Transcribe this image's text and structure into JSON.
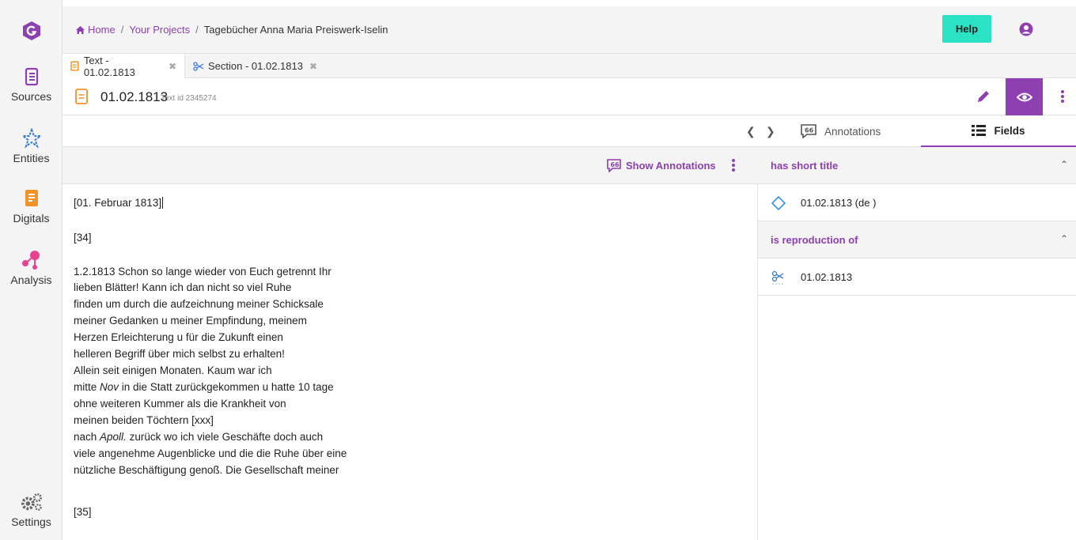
{
  "breadcrumb": {
    "home": "Home",
    "projects": "Your Projects",
    "current": "Tagebücher Anna Maria Preiswerk-Iselin"
  },
  "header": {
    "help_label": "Help"
  },
  "sidebar": {
    "items": [
      {
        "label": "Sources",
        "icon": "scroll-icon"
      },
      {
        "label": "Entities",
        "icon": "star-icon"
      },
      {
        "label": "Digitals",
        "icon": "document-icon"
      },
      {
        "label": "Analysis",
        "icon": "network-icon"
      },
      {
        "label": "Settings",
        "icon": "gears-icon"
      }
    ]
  },
  "tabs": [
    {
      "label": "Text - 01.02.1813",
      "close": "✖"
    },
    {
      "label": "Section - 01.02.1813",
      "close": "✖"
    }
  ],
  "document": {
    "title": "01.02.1813",
    "subtitle": "Text id 2345274"
  },
  "toolbar": {
    "show_annotations": "Show Annotations"
  },
  "text": {
    "lines": [
      "[01. Februar 1813]",
      "[34]",
      "1.2.1813 Schon so lange wieder von Euch getrennt Ihr",
      "lieben Blätter! Kann ich dan nicht so viel Ruhe",
      "finden um durch die aufzeichnung meiner Schicksale",
      "meiner Gedanken u meiner Empfindung, meinem",
      "Herzen Erleichterung u für die Zukunft einen",
      "helleren Begriff über mich selbst zu erhalten!",
      "Allein seit einigen Monaten. Kaum war ich",
      "mitte ",
      "Nov",
      " in die Statt zurückgekommen u hatte 10 tage",
      "ohne weiteren Kummer als die Krankheit von",
      "meinen beiden Töchtern [xxx]",
      "nach ",
      "Apoll.",
      " zurück wo ich viele Geschäfte doch auch",
      "viele angenehme Augenblicke und die die Ruhe über eine",
      "nützliche Beschäftigung genoß. Die Gesellschaft meiner",
      "[35]"
    ]
  },
  "right_panel": {
    "tabs": {
      "annotations": "Annotations",
      "fields": "Fields"
    },
    "fields": [
      {
        "name": "has short title",
        "value": "01.02.1813 (de )"
      },
      {
        "name": "is reproduction of",
        "value": "01.02.1813"
      }
    ]
  },
  "colors": {
    "accent": "#8e3fb0",
    "help": "#2be3c4",
    "digitals": "#f0932b",
    "analysis": "#e84393"
  }
}
